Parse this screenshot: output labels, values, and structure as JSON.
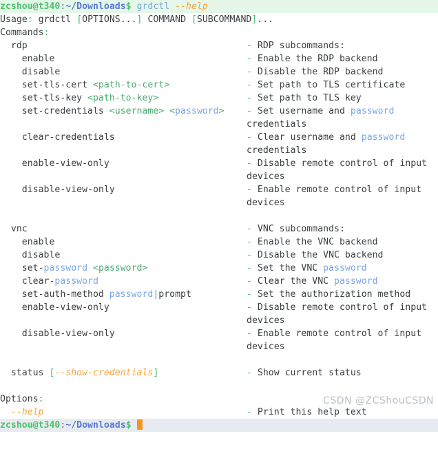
{
  "terminal": {
    "prompt_top": {
      "user_host": "zcshou@t340",
      "colon": ":",
      "path": "~/Downloads",
      "dollar": "$",
      "space": " ",
      "command": "grdctl",
      "option": "--help"
    },
    "prompt_bottom": {
      "user_host": "zcshou@t340",
      "colon": ":",
      "path": "~/Downloads",
      "dollar": "$",
      "cursor": ""
    },
    "usage": {
      "label": "Usage",
      "colon": ":",
      "command": " grdctl ",
      "bracket_open": "[",
      "options": "OPTIONS...",
      "bracket_close": "]",
      "middle": " COMMAND ",
      "bracket_open2": "[",
      "subcommand": "SUBCOMMAND",
      "bracket_close2": "]",
      "ellipsis": "..."
    },
    "commands_header": {
      "label": "Commands",
      "colon": ":"
    },
    "options_header": {
      "label": "Options",
      "colon": ":"
    },
    "rdp": {
      "name": "  rdp",
      "desc": "RDP subcommands:",
      "rows": [
        {
          "cmd": "    enable",
          "desc": "Enable the RDP backend"
        },
        {
          "cmd": "    disable",
          "desc": "Disable the RDP backend"
        },
        {
          "cmd": "    set-tls-cert ",
          "arg": "<path-to-cert>",
          "desc": "Set path to TLS certificate"
        },
        {
          "cmd": "    set-tls-key ",
          "arg": "<path-to-key>",
          "desc": "Set path to TLS key"
        },
        {
          "cmd": "    set-credentials ",
          "arg": "<username> <",
          "arg_pw": "password",
          "arg_end": ">",
          "desc": "Set username and ",
          "desc_pw": "password"
        },
        {
          "cont": "credentials"
        },
        {
          "cmd": "    clear-credentials",
          "desc": "Clear username and ",
          "desc_pw": "password"
        },
        {
          "cont": "credentials"
        },
        {
          "cmd": "    enable-view-only",
          "desc": "Disable remote control of input"
        },
        {
          "cont": "devices"
        },
        {
          "cmd": "    disable-view-only",
          "desc": "Enable remote control of input"
        },
        {
          "cont": "devices"
        }
      ]
    },
    "vnc": {
      "name": "  vnc",
      "desc": "VNC subcommands:",
      "rows": [
        {
          "cmd": "    enable",
          "desc": "Enable the VNC backend"
        },
        {
          "cmd": "    disable",
          "desc": "Disable the VNC backend"
        },
        {
          "cmd_a": "    set-",
          "cmd_pw": "password",
          "arg": " <password>",
          "desc": "Set the VNC ",
          "desc_pw": "password"
        },
        {
          "cmd_a": "    clear-",
          "cmd_pw": "password",
          "desc": "Clear the VNC ",
          "desc_pw": "password"
        },
        {
          "cmd_a": "    set-auth-method ",
          "cmd_pw": "password",
          "pipe": "|",
          "cmd_b": "prompt",
          "desc": "Set the authorization method"
        },
        {
          "cmd": "    enable-view-only",
          "desc": "Disable remote control of input"
        },
        {
          "cont": "devices"
        },
        {
          "cmd": "    disable-view-only",
          "desc": "Enable remote control of input"
        },
        {
          "cont": "devices"
        }
      ]
    },
    "status": {
      "cmd": "  status ",
      "bracket_open": "[",
      "flag": "--show-credentials",
      "bracket_close": "]",
      "desc": "Show current status"
    },
    "help_option": {
      "flag": "  --help",
      "desc": "Print this help text"
    },
    "dash": "- ",
    "watermark": "CSDN @ZCShouCSDN"
  }
}
